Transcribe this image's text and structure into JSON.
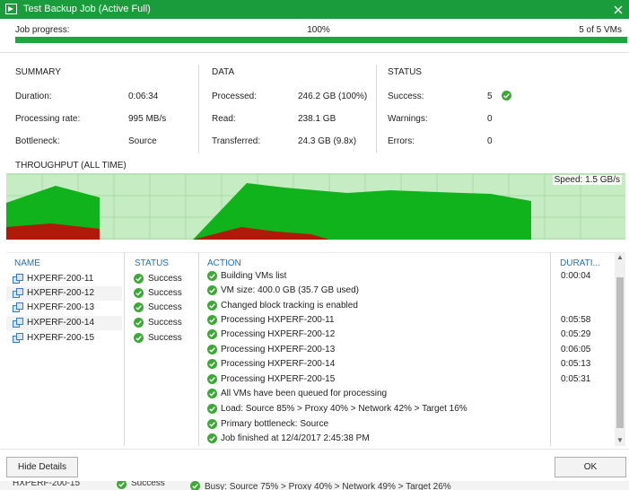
{
  "window": {
    "title": "Test Backup Job (Active Full)"
  },
  "progress": {
    "label": "Job progress:",
    "percent_text": "100%",
    "count_text": "5 of 5 VMs",
    "fraction": 1.0
  },
  "summary": {
    "title": "SUMMARY",
    "duration_label": "Duration:",
    "duration_value": "0:06:34",
    "rate_label": "Processing rate:",
    "rate_value": "995 MB/s",
    "bottleneck_label": "Bottleneck:",
    "bottleneck_value": "Source"
  },
  "data_section": {
    "title": "DATA",
    "processed_label": "Processed:",
    "processed_value": "246.2 GB (100%)",
    "read_label": "Read:",
    "read_value": "238.1 GB",
    "transferred_label": "Transferred:",
    "transferred_value": "24.3 GB (9.8x)"
  },
  "status_section": {
    "title": "STATUS",
    "success_label": "Success:",
    "success_value": "5",
    "warnings_label": "Warnings:",
    "warnings_value": "0",
    "errors_label": "Errors:",
    "errors_value": "0"
  },
  "throughput": {
    "title": "THROUGHPUT (ALL TIME)",
    "speed_label": "Speed: 1.5 GB/s",
    "colors": {
      "background": "#c6ecc4",
      "grid": "#a9dca6",
      "fill": "#10b31c",
      "bottleneck": "#b01a0a"
    }
  },
  "columns": {
    "name": "NAME",
    "status": "STATUS",
    "action": "ACTION",
    "duration": "DURATI..."
  },
  "vms": [
    {
      "name": "HXPERF-200-11",
      "status": "Success"
    },
    {
      "name": "HXPERF-200-12",
      "status": "Success"
    },
    {
      "name": "HXPERF-200-13",
      "status": "Success"
    },
    {
      "name": "HXPERF-200-14",
      "status": "Success"
    },
    {
      "name": "HXPERF-200-15",
      "status": "Success"
    }
  ],
  "actions": [
    {
      "text": "Building VMs list",
      "duration": "0:00:04"
    },
    {
      "text": "VM size: 400.0 GB (35.7 GB used)",
      "duration": ""
    },
    {
      "text": "Changed block tracking is enabled",
      "duration": ""
    },
    {
      "text": "Processing HXPERF-200-11",
      "duration": "0:05:58"
    },
    {
      "text": "Processing HXPERF-200-12",
      "duration": "0:05:29"
    },
    {
      "text": "Processing HXPERF-200-13",
      "duration": "0:06:05"
    },
    {
      "text": "Processing HXPERF-200-14",
      "duration": "0:05:13"
    },
    {
      "text": "Processing HXPERF-200-15",
      "duration": "0:05:31"
    },
    {
      "text": "All VMs have been queued for processing",
      "duration": ""
    },
    {
      "text": "Load: Source 85% > Proxy 40% > Network 42% > Target 16%",
      "duration": ""
    },
    {
      "text": "Primary bottleneck: Source",
      "duration": ""
    },
    {
      "text": "Job finished at 12/4/2017 2:45:38 PM",
      "duration": ""
    }
  ],
  "buttons": {
    "hide_details": "Hide Details",
    "ok": "OK"
  },
  "background_window": {
    "vm_name": "HXPERF-200-15",
    "status": "Success",
    "action": "Busy: Source 75% > Proxy 40% > Network 49% > Target 26%"
  },
  "accent_colors": {
    "titlebar": "#1a9c3c",
    "progress": "#1ca83f",
    "header_text": "#2a6fb4",
    "success_icon": "#3aaa35"
  }
}
